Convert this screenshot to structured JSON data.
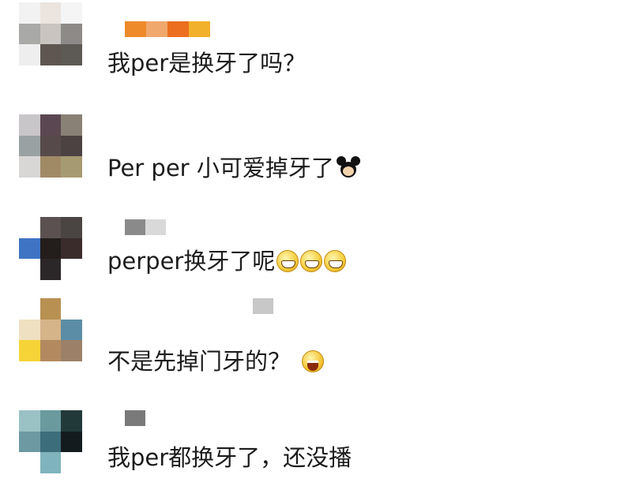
{
  "comments": [
    {
      "text": "我per是换牙了吗？",
      "emojis": [],
      "avatar_colors": [
        "#f2f2f2",
        "#ebe4df",
        "#f5f5f5",
        "#a9a9a7",
        "#c9c4c0",
        "#8d8a88",
        "#eeeeee",
        "#5f5651",
        "#5d5954"
      ],
      "name_colors": [
        "#ef8a2a",
        "#f0a86d",
        "#eb6f1e",
        "#f2b12a"
      ]
    },
    {
      "text": "Per per 小可爱掉牙了",
      "emojis": [
        "mickey-icon"
      ],
      "avatar_colors": [
        "#c9c6c9",
        "#5b4751",
        "#8a8176",
        "#9aa1a2",
        "#574a4a",
        "#4c4242",
        "#d9d7d5",
        "#a08a66",
        "#a69a72"
      ],
      "name_colors": []
    },
    {
      "text": "perper换牙了呢",
      "emojis": [
        "grin-icon",
        "grin-icon",
        "grin-icon"
      ],
      "avatar_colors": [
        "#ffffff",
        "#5a5150",
        "#4a4442",
        "#3f74c4",
        "#231d1c",
        "#3b2c2c",
        "#ffffff",
        "#2b2728",
        "#ffffff"
      ],
      "name_colors": [
        "#8a8a8a",
        "#d9d9d9"
      ]
    },
    {
      "text": "不是先掉门牙的？",
      "emojis": [
        "laugh-icon"
      ],
      "avatar_colors": [
        "#ffffff",
        "#b89052",
        "#ffffff",
        "#efe0c1",
        "#d6b48a",
        "#5b8ea6",
        "#f6d337",
        "#b38a60",
        "#9c8168"
      ],
      "name_colors": [
        "#c8c8c8"
      ]
    },
    {
      "text": "我per都换牙了，还没播",
      "emojis": [],
      "avatar_colors": [
        "#9ac2c4",
        "#6a9a9e",
        "#213a39",
        "#6d9aa2",
        "#3c6d7a",
        "#141b1f",
        "#ffffff",
        "#7fb3bd",
        "#ffffff"
      ],
      "name_colors": [
        "#7a7a7a"
      ]
    }
  ]
}
